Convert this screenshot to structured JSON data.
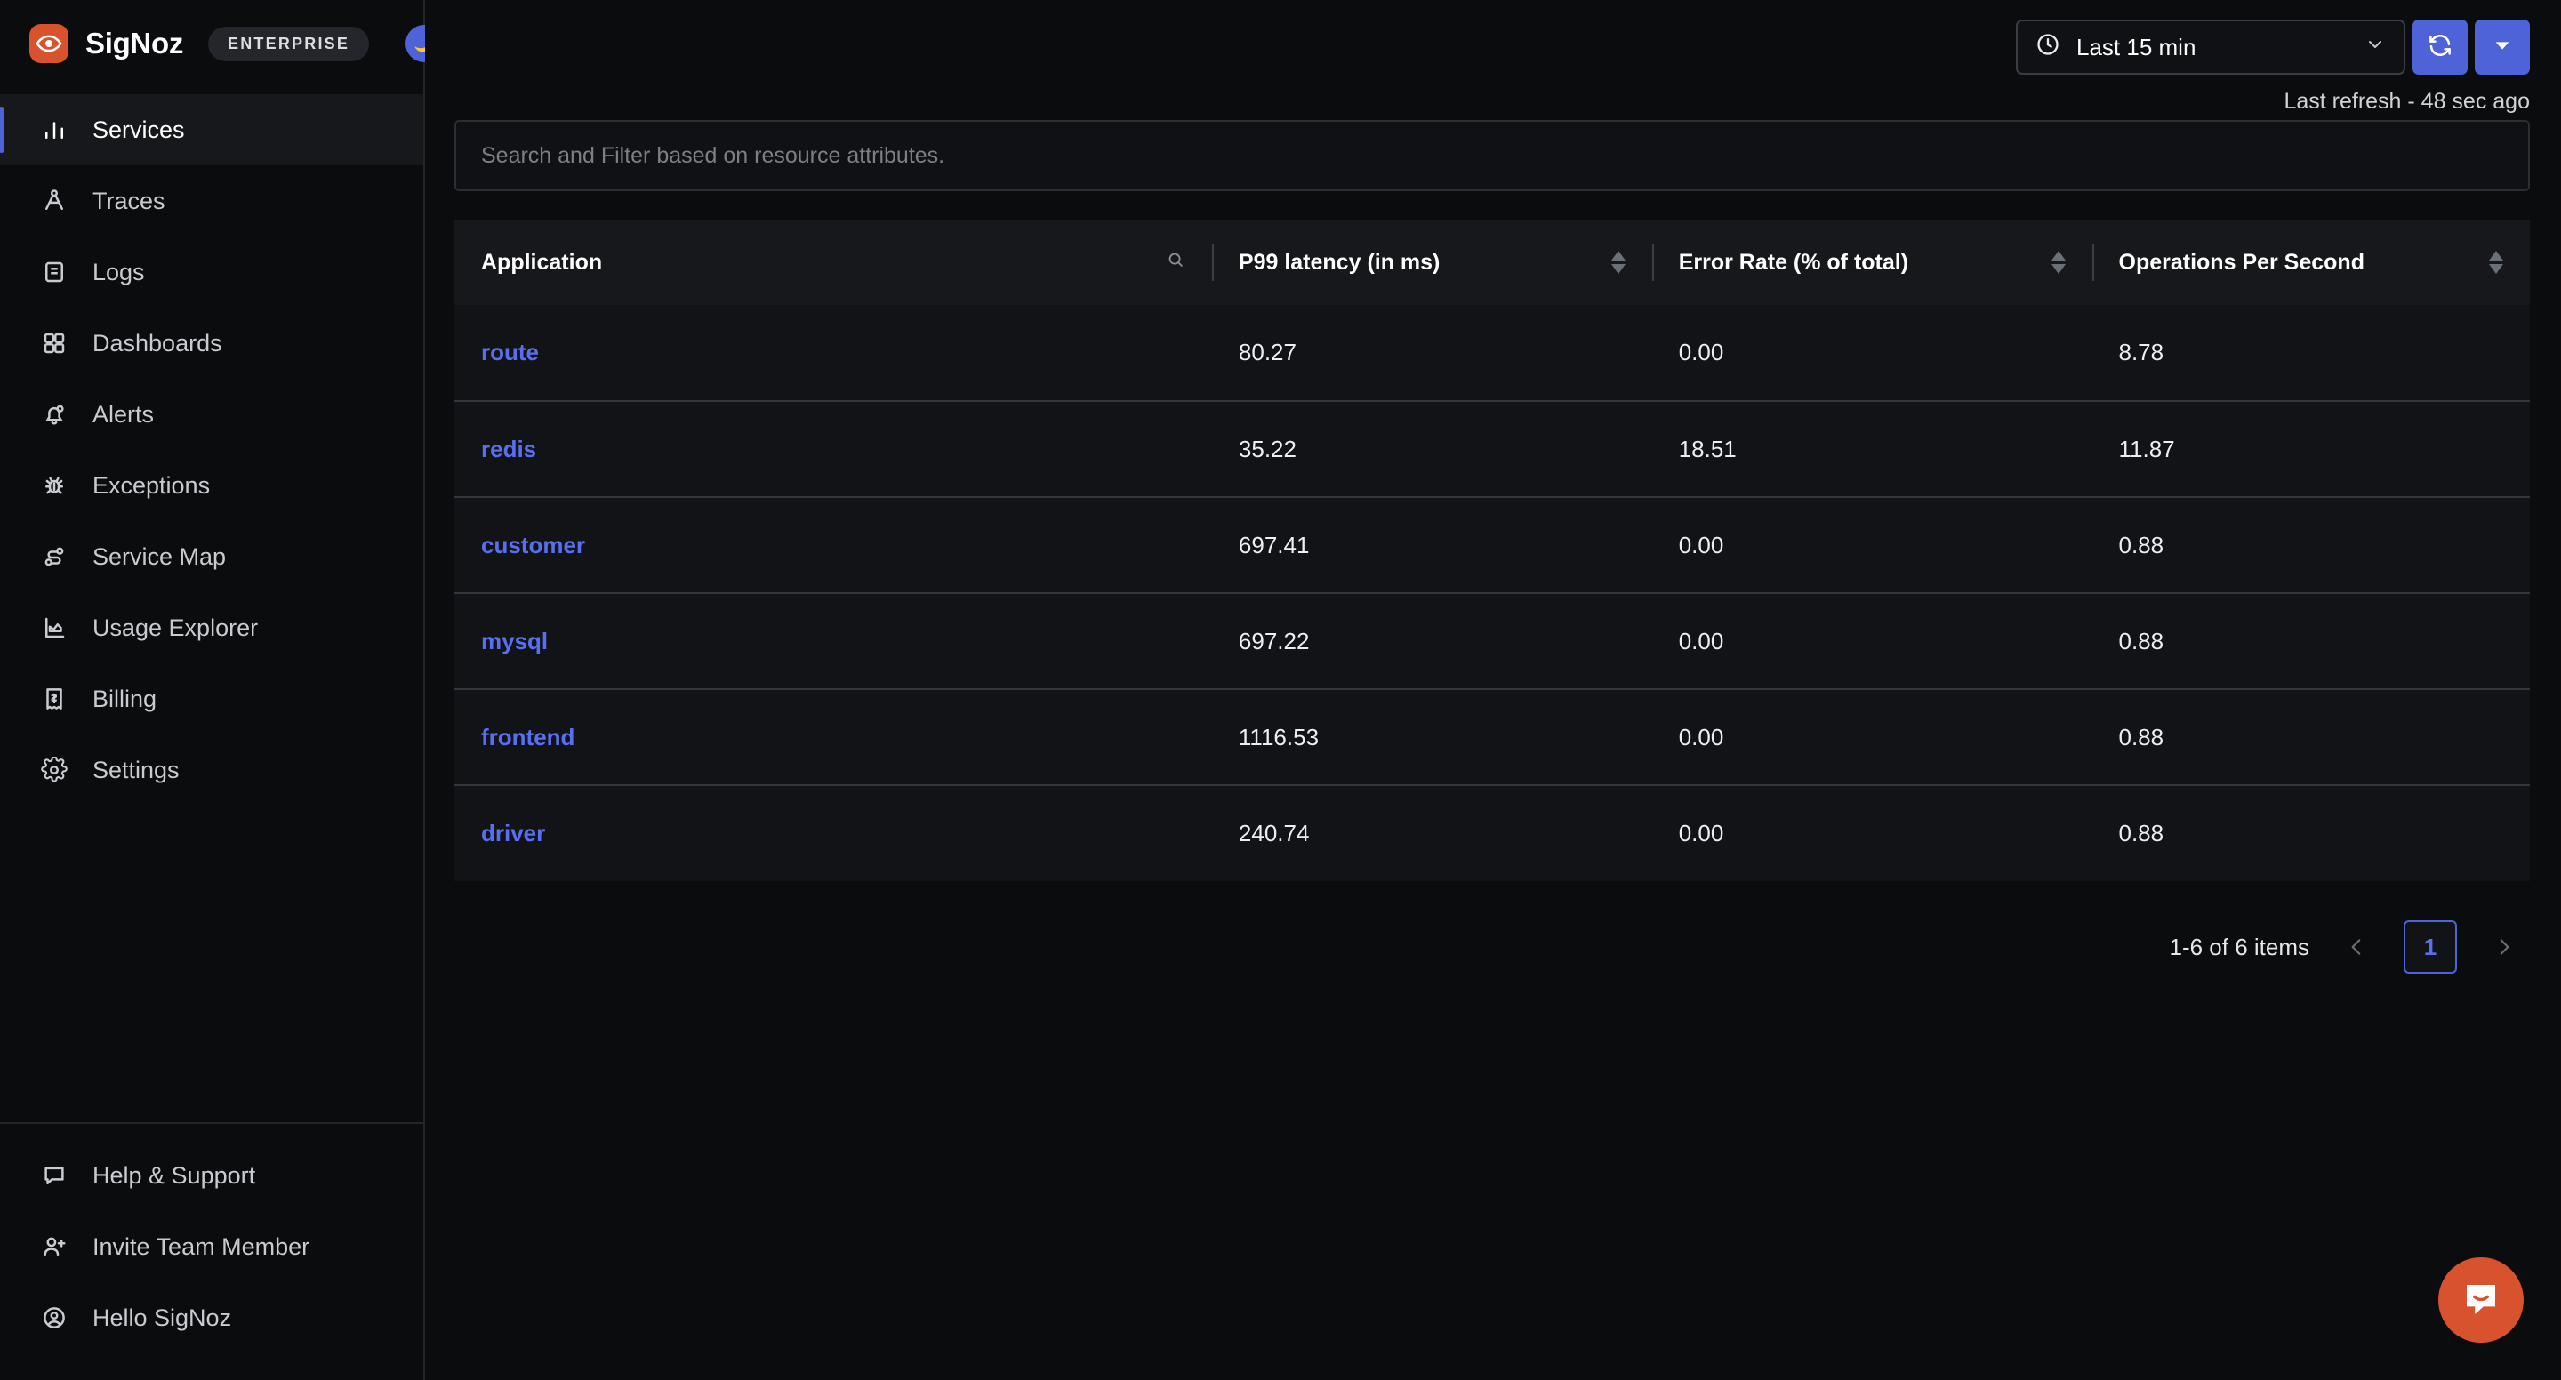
{
  "brand": {
    "name": "SigNoz",
    "badge": "ENTERPRISE",
    "logo_icon": "eye-icon",
    "theme_toggle_icon": "moon-icon",
    "accent_color": "#4e63d8",
    "logo_color": "#d9522e"
  },
  "sidebar": {
    "main_items": [
      {
        "label": "Services",
        "icon": "bar-chart-icon",
        "active": true
      },
      {
        "label": "Traces",
        "icon": "traces-icon",
        "active": false
      },
      {
        "label": "Logs",
        "icon": "logs-scroll-icon",
        "active": false
      },
      {
        "label": "Dashboards",
        "icon": "grid-icon",
        "active": false
      },
      {
        "label": "Alerts",
        "icon": "bell-icon",
        "active": false
      },
      {
        "label": "Exceptions",
        "icon": "bug-icon",
        "active": false
      },
      {
        "label": "Service Map",
        "icon": "service-map-icon",
        "active": false
      },
      {
        "label": "Usage Explorer",
        "icon": "area-chart-icon",
        "active": false
      },
      {
        "label": "Billing",
        "icon": "receipt-icon",
        "active": false
      },
      {
        "label": "Settings",
        "icon": "gear-icon",
        "active": false
      }
    ],
    "bottom_items": [
      {
        "label": "Help & Support",
        "icon": "chat-bubble-icon"
      },
      {
        "label": "Invite Team Member",
        "icon": "user-plus-icon"
      },
      {
        "label": "Hello SigNoz",
        "icon": "user-circle-icon"
      }
    ]
  },
  "topbar": {
    "time_range": "Last 15 min",
    "time_icon": "clock-icon",
    "dropdown_icon": "chevron-down-icon",
    "refresh_icon": "refresh-icon",
    "refresh_options_icon": "caret-down-icon",
    "last_refresh": "Last refresh - 48 sec ago"
  },
  "search": {
    "placeholder": "Search and Filter based on resource attributes."
  },
  "table": {
    "columns": [
      {
        "label": "Application",
        "icon": "search-icon",
        "sortable": false
      },
      {
        "label": "P99 latency (in ms)",
        "icon": "sort-icon",
        "sortable": true
      },
      {
        "label": "Error Rate (% of total)",
        "icon": "sort-icon",
        "sortable": true
      },
      {
        "label": "Operations Per Second",
        "icon": "sort-icon",
        "sortable": true
      }
    ],
    "rows": [
      {
        "application": "route",
        "p99_latency": "80.27",
        "error_rate": "0.00",
        "ops_per_second": "8.78"
      },
      {
        "application": "redis",
        "p99_latency": "35.22",
        "error_rate": "18.51",
        "ops_per_second": "11.87"
      },
      {
        "application": "customer",
        "p99_latency": "697.41",
        "error_rate": "0.00",
        "ops_per_second": "0.88"
      },
      {
        "application": "mysql",
        "p99_latency": "697.22",
        "error_rate": "0.00",
        "ops_per_second": "0.88"
      },
      {
        "application": "frontend",
        "p99_latency": "1116.53",
        "error_rate": "0.00",
        "ops_per_second": "0.88"
      },
      {
        "application": "driver",
        "p99_latency": "240.74",
        "error_rate": "0.00",
        "ops_per_second": "0.88"
      }
    ]
  },
  "pagination": {
    "info": "1-6 of 6 items",
    "prev_icon": "chevron-left-icon",
    "next_icon": "chevron-right-icon",
    "current_page": "1"
  },
  "chat_widget": {
    "icon": "intercom-chat-icon"
  }
}
